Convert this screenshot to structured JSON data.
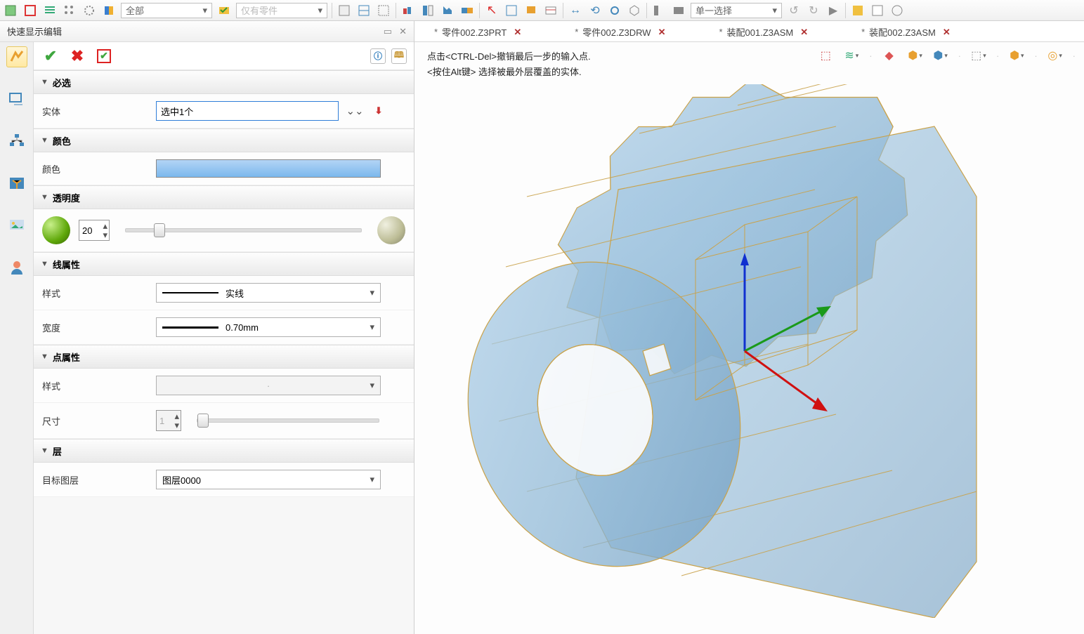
{
  "top_toolbar": {
    "combo1": "全部",
    "combo2": "仅有零件",
    "combo3": "单一选择"
  },
  "panel": {
    "title": "快速显示编辑"
  },
  "sections": {
    "required": "必选",
    "entity_label": "实体",
    "entity_value": "选中1个",
    "color_section": "颜色",
    "color_label": "颜色",
    "transparency_section": "透明度",
    "transparency_value": "20",
    "line_section": "线属性",
    "line_style_label": "样式",
    "line_style_value": "实线",
    "line_width_label": "宽度",
    "line_width_value": "0.70mm",
    "point_section": "点属性",
    "point_style_label": "样式",
    "point_style_value": "·",
    "point_size_label": "尺寸",
    "point_size_value": "1",
    "layer_section": "层",
    "layer_label": "目标图层",
    "layer_value": "图层0000"
  },
  "tabs": [
    {
      "modified": true,
      "name": "零件002.Z3PRT"
    },
    {
      "modified": true,
      "name": "零件002.Z3DRW"
    },
    {
      "modified": true,
      "name": "装配001.Z3ASM"
    },
    {
      "modified": true,
      "name": "装配002.Z3ASM"
    }
  ],
  "hints": {
    "line1": "点击<CTRL-Del>撤销最后一步的输入点.",
    "line2": "<按住Alt键> 选择被最外层覆盖的实体."
  },
  "viewport_tools": {
    "t1": "◫",
    "t2": "≋",
    "t3": "◆",
    "t4": "⬚",
    "t5": "⬢",
    "t6": "◯",
    "t7": "⧖",
    "t8": "◎"
  }
}
